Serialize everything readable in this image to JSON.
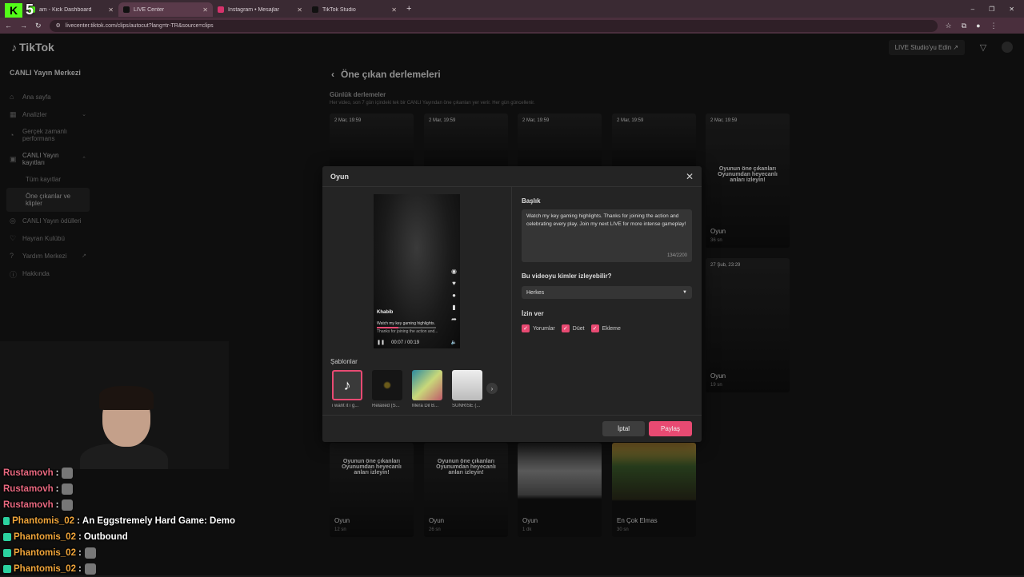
{
  "browser": {
    "tabs": [
      {
        "label": "am - Kick Dashboard"
      },
      {
        "label": "LIVE Center"
      },
      {
        "label": "Instagram • Mesajlar"
      },
      {
        "label": "TikTok Studio"
      }
    ],
    "url": "livecenter.tiktok.com/clips/autocut?lang=tr-TR&source=clips"
  },
  "kick": {
    "count": "5"
  },
  "app": {
    "logo": "TikTok",
    "studio_button": "LIVE Studio'yu Edin ↗"
  },
  "sidebar": {
    "title": "CANLI Yayın Merkezi",
    "items": [
      {
        "label": "Ana sayfa"
      },
      {
        "label": "Analizler"
      },
      {
        "label": "Gerçek zamanlı performans"
      },
      {
        "label": "CANLI Yayın kayıtları"
      },
      {
        "label": "CANLI Yayın ödülleri"
      },
      {
        "label": "Hayran Kulübü"
      },
      {
        "label": "Yardım Merkezi"
      },
      {
        "label": "Hakkında"
      }
    ],
    "subitems": [
      {
        "label": "Tüm kayıtlar"
      },
      {
        "label": "Öne çıkanlar ve klipler"
      }
    ]
  },
  "main": {
    "title": "Öne çıkan derlemeleri",
    "section_title": "Günlük derlemeler",
    "section_desc": "Her video, son 7 gün içindeki tek bir CANLI Yayından öne çıkanları yer verir. Her gün güncellenir.",
    "clips_top": [
      {
        "date": "2 Mar, 19:59"
      },
      {
        "date": "2 Mar, 19:59"
      },
      {
        "date": "2 Mar, 19:59"
      },
      {
        "date": "2 Mar, 19:59"
      }
    ],
    "clip_right1": {
      "date": "2 Mar, 19:59",
      "overlay": "Oyunun öne çıkanları Oyunumdan heyecanlı anları izleyin!",
      "title": "Oyun",
      "duration": "36 sn"
    },
    "clip_right2": {
      "date": "27 Şub, 23:29",
      "title": "Oyun",
      "duration": "19 sn"
    },
    "clips_bottom": [
      {
        "overlay": "Oyunun öne çıkanları Oyunumdan heyecanlı anları izleyin!",
        "title": "Oyun",
        "duration": "12 sn"
      },
      {
        "overlay": "Oyunun öne çıkanları Oyunumdan heyecanlı anları izleyin!",
        "title": "Oyun",
        "duration": "26 sn"
      },
      {
        "overlay": "",
        "title": "Oyun",
        "duration": "1 dk"
      },
      {
        "overlay": "",
        "title": "En Çok Elmas",
        "duration": "30 sn"
      }
    ]
  },
  "modal": {
    "title": "Oyun",
    "preview": {
      "name": "Khabib",
      "caption1": "Watch my key gaming highlights.",
      "caption2": "Thanks for joining the action and...",
      "time": "00:07 / 00:19",
      "progress": 0.37
    },
    "templates_label": "Şablonlar",
    "templates": [
      {
        "name": "i want it i g..."
      },
      {
        "name": "Relaxed (S..."
      },
      {
        "name": "Mera Dil B..."
      },
      {
        "name": "SUNRISE (..."
      }
    ],
    "title_label": "Başlık",
    "description": "Watch my key gaming highlights. Thanks for joining the action and celebrating every play. Join my next LIVE for more intense gameplay!",
    "char_count": "134/2200",
    "privacy_label": "Bu videoyu kimler izleyebilir?",
    "privacy_value": "Herkes",
    "allow_label": "İzin ver",
    "checks": [
      {
        "label": "Yorumlar"
      },
      {
        "label": "Düet"
      },
      {
        "label": "Ekleme"
      }
    ],
    "cancel": "İptal",
    "share": "Paylaş"
  },
  "chat": [
    {
      "user": "Rustamovh",
      "sep": ":",
      "message": "",
      "color": "#e8687f",
      "badge": false
    },
    {
      "user": "Rustamovh",
      "sep": ":",
      "message": "",
      "color": "#e8687f",
      "badge": false
    },
    {
      "user": "Rustamovh",
      "sep": ":",
      "message": "",
      "color": "#e8687f",
      "badge": false
    },
    {
      "user": "Phantomis_02",
      "sep": ":",
      "message": "An Eggstremely Hard Game: Demo",
      "color": "#f0a53a",
      "badge": true
    },
    {
      "user": "Phantomis_02",
      "sep": ":",
      "message": "Outbound",
      "color": "#f0a53a",
      "badge": true
    },
    {
      "user": "Phantomis_02",
      "sep": ":",
      "message": "",
      "color": "#f0a53a",
      "badge": true
    },
    {
      "user": "Phantomis_02",
      "sep": ":",
      "message": "",
      "color": "#f0a53a",
      "badge": true
    }
  ],
  "colors": {
    "accent": "#e84a72",
    "kick_green": "#53fc18"
  }
}
